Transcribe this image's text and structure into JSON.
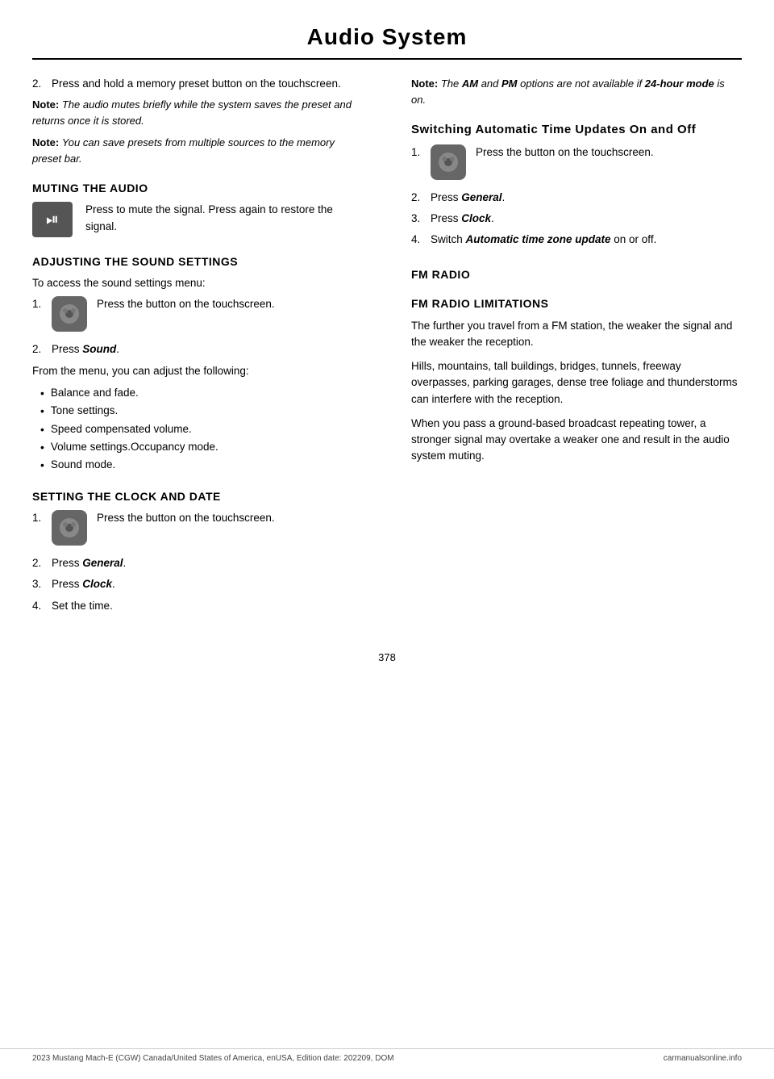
{
  "header": {
    "title": "Audio System"
  },
  "left_col": {
    "intro_items": [
      "Press and hold a memory preset button on the touchscreen."
    ],
    "note1_label": "Note:",
    "note1_text": "The audio mutes briefly while the system saves the preset and returns once it is stored.",
    "note2_label": "Note:",
    "note2_text": "You can save presets from multiple sources to the memory preset bar.",
    "muting_heading": "MUTING THE AUDIO",
    "muting_desc": "Press to mute the signal. Press again to restore the signal.",
    "sound_heading": "ADJUSTING THE SOUND SETTINGS",
    "sound_intro": "To access the sound settings menu:",
    "sound_step1_text": "Press the button on the touchscreen.",
    "sound_step2": "Press ",
    "sound_step2_bold": "Sound",
    "sound_step2_end": ".",
    "sound_from": "From the menu, you can adjust the following:",
    "sound_bullets": [
      "Balance and fade.",
      "Tone settings.",
      "Speed compensated volume.",
      "Volume settings.Occupancy mode.",
      "Sound mode."
    ],
    "clock_heading": "SETTING THE CLOCK AND DATE",
    "clock_step1_text": "Press the button on the touchscreen.",
    "clock_step2": "Press ",
    "clock_step2_bold": "General",
    "clock_step2_end": ".",
    "clock_step3": "Press ",
    "clock_step3_bold": "Clock",
    "clock_step3_end": ".",
    "clock_step4": "Set the time."
  },
  "right_col": {
    "note_label": "Note:",
    "note_text_pre": "The ",
    "note_am": "AM",
    "note_text_mid": " and ",
    "note_pm": "PM",
    "note_text_post": " options are not available if ",
    "note_24h": "24-hour mode",
    "note_text_end": " is on.",
    "switching_heading": "Switching Automatic Time Updates On and Off",
    "switch_step1_text": "Press the button on the touchscreen.",
    "switch_step2": "Press ",
    "switch_step2_bold": "General",
    "switch_step2_end": ".",
    "switch_step3": "Press ",
    "switch_step3_bold": "Clock",
    "switch_step3_end": ".",
    "switch_step4_pre": "Switch ",
    "switch_step4_bold": "Automatic time zone update",
    "switch_step4_end": " on or off.",
    "fm_radio_heading": "FM RADIO",
    "fm_limitations_heading": "FM RADIO LIMITATIONS",
    "fm_para1": "The further you travel from a FM station, the weaker the signal and the weaker the reception.",
    "fm_para2": "Hills, mountains, tall buildings, bridges, tunnels, freeway overpasses, parking garages, dense tree foliage and thunderstorms can interfere with the reception.",
    "fm_para3": "When you pass a ground-based broadcast repeating tower, a stronger signal may overtake a weaker one and result in the audio system muting."
  },
  "footer": {
    "left": "2023 Mustang Mach-E (CGW) Canada/United States of America, enUSA, Edition date: 202209, DOM",
    "right": "carmanualsonline.info"
  },
  "page_number": "378"
}
